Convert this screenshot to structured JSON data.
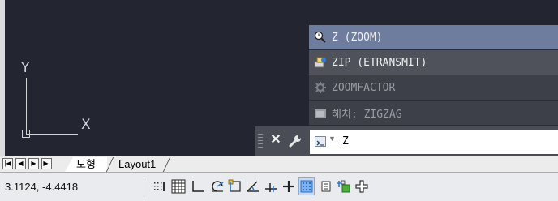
{
  "viewport": {
    "ucs_y_label": "Y",
    "ucs_x_label": "X"
  },
  "autocomplete": {
    "items": [
      {
        "label": "Z (ZOOM)",
        "icon": "zoom-icon",
        "state": "selected"
      },
      {
        "label": "ZIP (ETRANSMIT)",
        "icon": "etransmit-icon",
        "state": "hover"
      },
      {
        "label": "ZOOMFACTOR",
        "icon": "system-variable-gear-icon",
        "state": "dim"
      },
      {
        "label": "해치: ZIGZAG",
        "icon": "hatch-pattern-icon",
        "state": "normal"
      }
    ]
  },
  "command_line": {
    "close_label": "✕",
    "input_text": "Z",
    "prompt_icon": "command-prompt-icon",
    "customize_icon": "wrench-icon"
  },
  "layout_tabs": {
    "nav": [
      "|◀",
      "◀",
      "▶",
      "▶|"
    ],
    "tabs": [
      {
        "label": "모형",
        "active": true
      },
      {
        "label": "Layout1",
        "active": false
      }
    ]
  },
  "status_bar": {
    "coordinates": "3.1124,  -4.4418",
    "toggles": [
      {
        "name": "snap-mode-icon",
        "on": false
      },
      {
        "name": "grid-display-icon",
        "on": false
      },
      {
        "name": "ortho-mode-icon",
        "on": false
      },
      {
        "name": "polar-tracking-icon",
        "on": false
      },
      {
        "name": "object-snap-icon",
        "on": false
      },
      {
        "name": "object-snap-tracking-icon",
        "on": false
      },
      {
        "name": "dynamic-ucs-icon",
        "on": false
      },
      {
        "name": "dynamic-input-icon",
        "on": false
      },
      {
        "name": "lineweight-icon",
        "on": true
      },
      {
        "name": "quick-properties-icon",
        "on": false
      },
      {
        "name": "selection-cycling-icon",
        "on": false
      },
      {
        "name": "annotation-monitor-icon",
        "on": false
      }
    ]
  },
  "colors": {
    "canvas": "#232630",
    "selected_item": "#6e7d9e",
    "hover_item": "#4f525a",
    "list_bg": "#3b3e46",
    "accent_green": "#4caf3a"
  }
}
